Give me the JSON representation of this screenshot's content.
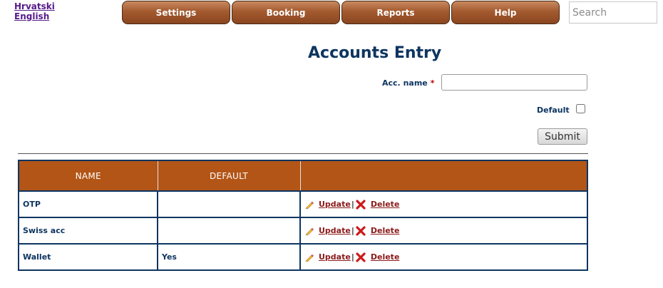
{
  "languages": [
    "Hrvatski",
    "English"
  ],
  "nav": [
    {
      "label": "Settings"
    },
    {
      "label": "Booking"
    },
    {
      "label": "Reports"
    },
    {
      "label": "Help"
    }
  ],
  "search": {
    "placeholder": "Search",
    "value": ""
  },
  "page_title": "Accounts Entry",
  "form": {
    "acc_name_label": "Acc. name",
    "required_mark": "*",
    "acc_name_value": "",
    "default_label": "Default",
    "default_checked": false,
    "submit_label": "Submit"
  },
  "table": {
    "headers": [
      "NAME",
      "DEFAULT",
      ""
    ],
    "rows": [
      {
        "name": "OTP",
        "default": ""
      },
      {
        "name": "Swiss acc",
        "default": ""
      },
      {
        "name": "Wallet",
        "default": "Yes"
      }
    ],
    "update_label": "Update",
    "separator": "|",
    "delete_label": "Delete"
  },
  "icons": {
    "update": "pencil-icon",
    "delete": "x-icon"
  },
  "colors": {
    "nav_button": "#a45a2f",
    "table_header": "#b25516",
    "title": "#0d3561",
    "link": "#8b1a1a",
    "delete_icon": "#cc1a1a"
  }
}
